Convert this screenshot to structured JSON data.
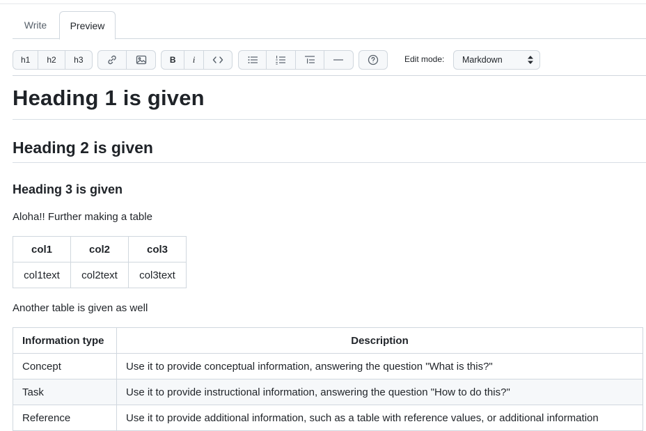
{
  "tabs": {
    "write": "Write",
    "preview": "Preview"
  },
  "toolbar": {
    "h1": "h1",
    "h2": "h2",
    "h3": "h3",
    "bold": "B",
    "italic": "i",
    "edit_mode_label": "Edit mode:",
    "edit_mode_value": "Markdown",
    "icons": [
      "link-icon",
      "image-icon",
      "code-icon",
      "unordered-list-icon",
      "ordered-list-icon",
      "task-list-icon",
      "horizontal-rule-icon",
      "help-icon"
    ]
  },
  "content": {
    "h1": "Heading 1 is given",
    "h2": "Heading 2 is given",
    "h3": "Heading 3 is given",
    "p1": "Aloha!! Further making a table",
    "table1": {
      "headers": [
        "col1",
        "col2",
        "col3"
      ],
      "rows": [
        [
          "col1text",
          "col2text",
          "col3text"
        ]
      ]
    },
    "p2": "Another table is given as well",
    "table2": {
      "headers": [
        "Information type",
        "Description"
      ],
      "rows": [
        [
          "Concept",
          "Use it to provide conceptual information, answering the question \"What is this?\""
        ],
        [
          "Task",
          "Use it to provide instructional information, answering the question \"How to do this?\""
        ],
        [
          "Reference",
          "Use it to provide additional information, such as a table with reference values, or additional information"
        ]
      ]
    }
  }
}
